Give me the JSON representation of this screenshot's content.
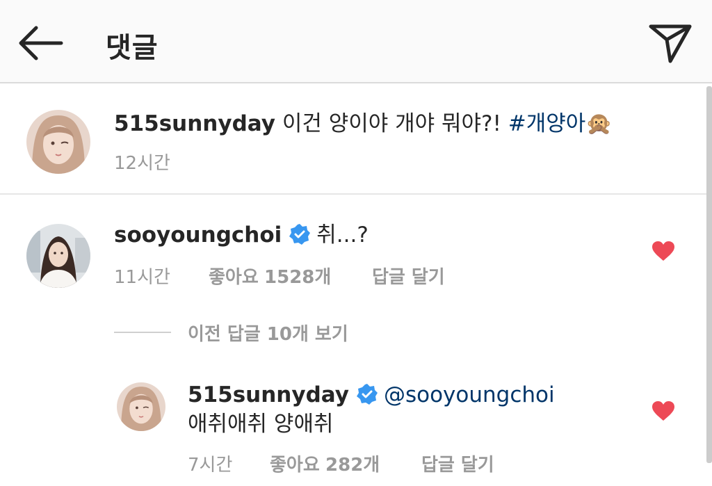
{
  "header": {
    "title": "댓글",
    "back_icon": "arrow-left-icon",
    "send_icon": "paper-plane-icon"
  },
  "caption": {
    "username": "515sunnyday",
    "text": "이건 양이야 개야 뭐야?!",
    "hashtag": "#개양아",
    "emoji": "🙊",
    "time": "12시간"
  },
  "comment": {
    "username": "sooyoungchoi",
    "verified": true,
    "text": "취...?",
    "time": "11시간",
    "likes_label": "좋아요",
    "likes_count": "1528개",
    "reply_label": "답글 달기",
    "liked": true
  },
  "view_more": {
    "label": "이전 답글 10개 보기"
  },
  "reply": {
    "username": "515sunnyday",
    "verified": true,
    "mention": "@sooyoungchoi",
    "text": "애취애취 양애취",
    "time": "7시간",
    "likes_label": "좋아요",
    "likes_count": "282개",
    "reply_label": "답글 달기",
    "liked": true
  },
  "colors": {
    "heart": "#ed4956",
    "verified": "#3897f0",
    "link": "#003569",
    "meta": "#999999"
  }
}
